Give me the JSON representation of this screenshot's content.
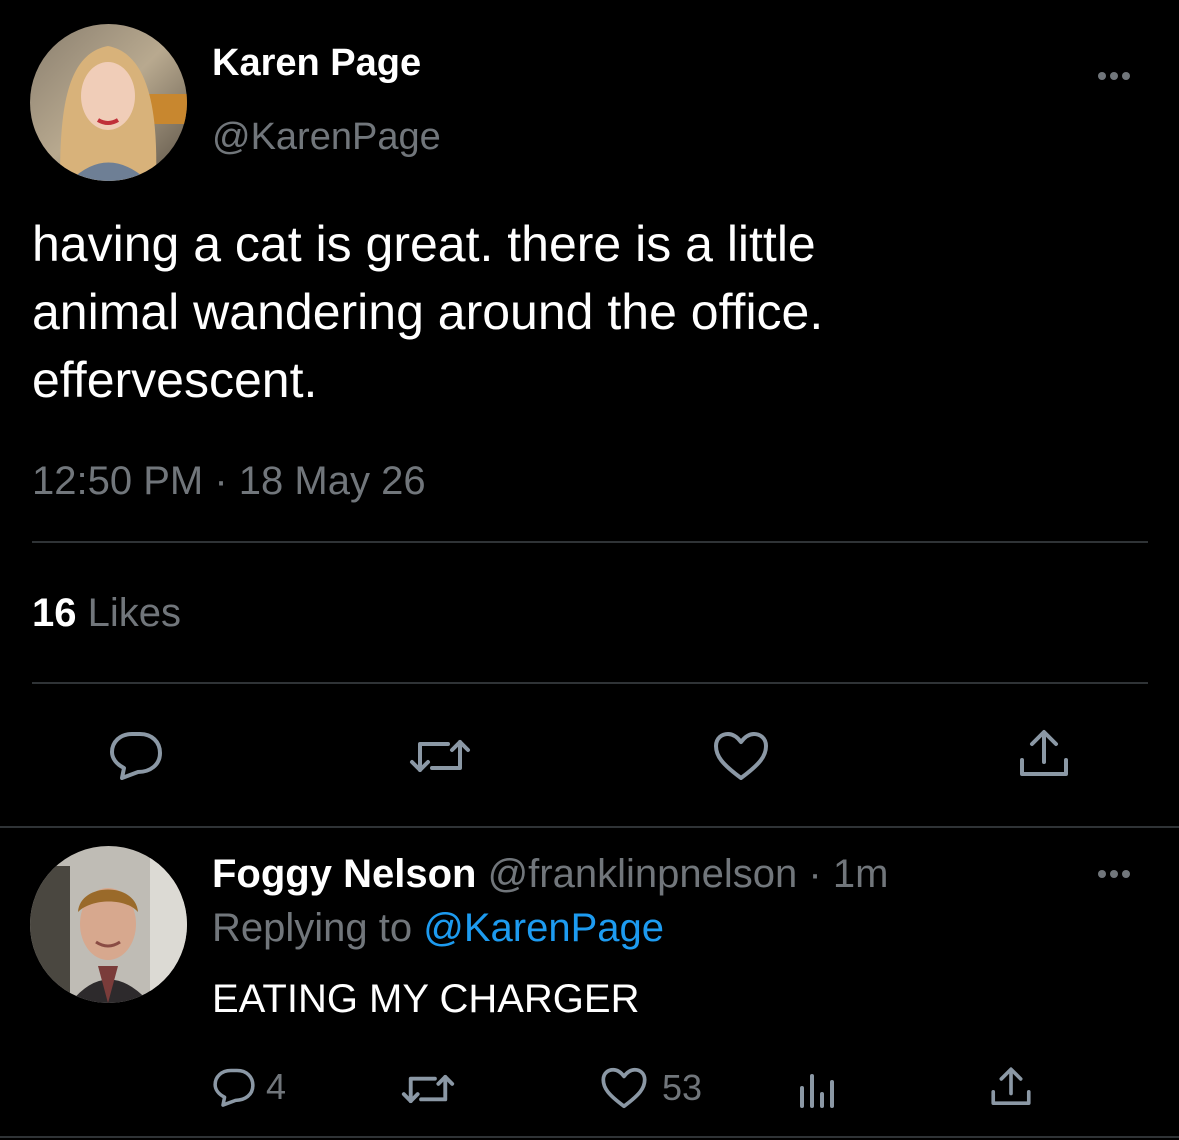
{
  "main_tweet": {
    "author_name": "Karen Page",
    "author_handle": "@KarenPage",
    "text_lines": [
      "having a cat is great. there is a little",
      "animal wandering around the office.",
      "effervescent."
    ],
    "time": "12:50 PM",
    "separator": "·",
    "date": "18 May 26",
    "likes_count": "16",
    "likes_label": "Likes",
    "more_icon": "more-horizontal-icon",
    "actions": [
      "reply-icon",
      "retweet-icon",
      "like-icon",
      "share-icon"
    ]
  },
  "reply": {
    "author_name": "Foggy Nelson",
    "author_handle": "@franklinpnelson",
    "separator": "·",
    "time_ago": "1m",
    "replying_prefix": "Replying to",
    "replying_to": "@KarenPage",
    "text": "EATING MY CHARGER",
    "reply_count": "4",
    "like_count": "53",
    "more_icon": "more-horizontal-icon",
    "actions": [
      "reply-icon",
      "retweet-icon",
      "like-icon",
      "analytics-icon",
      "share-icon"
    ]
  },
  "colors": {
    "background": "#000000",
    "text": "#e7e9ea",
    "muted": "#71767b",
    "link": "#1d9bf0",
    "divider": "#2f3336"
  }
}
